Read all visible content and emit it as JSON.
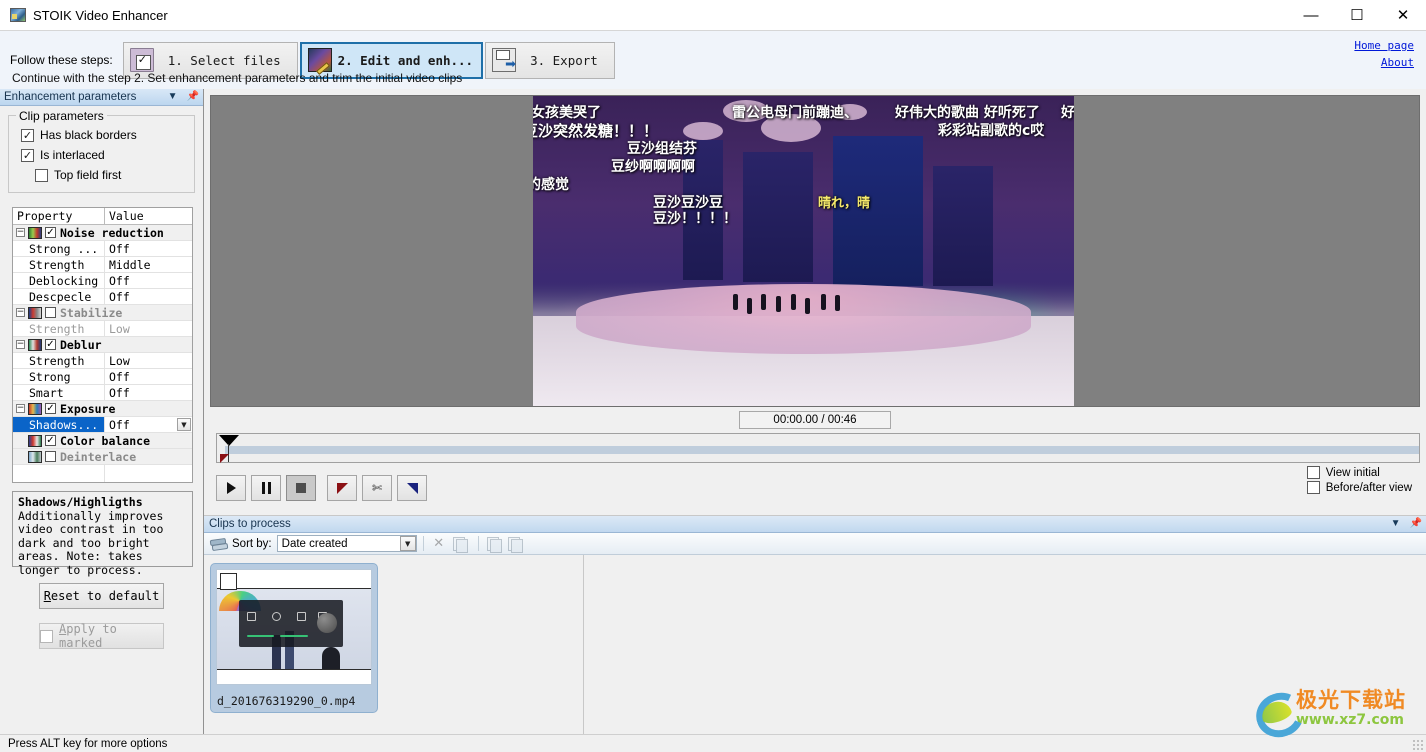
{
  "window": {
    "title": "STOIK Video Enhancer",
    "icon": "app-icon",
    "minimize": "—",
    "maximize": "☐",
    "close": "✕"
  },
  "toolbar": {
    "steps_label": "Follow these steps:",
    "steps": [
      {
        "label": "1. Select files",
        "icon": "select-files-icon",
        "active": false
      },
      {
        "label": "2. Edit and enh...",
        "icon": "edit-enhance-icon",
        "active": true
      },
      {
        "label": "3. Export",
        "icon": "export-icon",
        "active": false
      }
    ],
    "hint": "Continue with the step 2. Set enhancement parameters and trim the initial video clips",
    "links": [
      {
        "label": "Home page"
      },
      {
        "label": "About"
      }
    ]
  },
  "left_panel": {
    "title": "Enhancement parameters",
    "collapse_icon": "chevron-down-icon",
    "pin_icon": "pin-icon",
    "clip_parameters": {
      "group_title": "Clip parameters",
      "checkboxes": [
        {
          "label": "Has black borders",
          "checked": true
        },
        {
          "label": "Is interlaced",
          "checked": true
        },
        {
          "label": "Top field first",
          "checked": false
        }
      ]
    },
    "property_grid": {
      "headers": {
        "property": "Property",
        "value": "Value"
      },
      "rows": [
        {
          "kind": "group",
          "name": "Noise reduction",
          "checked": true,
          "expanded": true,
          "icon": "filmstrip-icon-1"
        },
        {
          "kind": "leaf",
          "name": "Strong ...",
          "value": "Off"
        },
        {
          "kind": "leaf",
          "name": "Strength",
          "value": "Middle"
        },
        {
          "kind": "leaf",
          "name": "Deblocking",
          "value": "Off"
        },
        {
          "kind": "leaf",
          "name": "Descpecle",
          "value": "Off"
        },
        {
          "kind": "group",
          "name": "Stabilize",
          "checked": false,
          "expanded": true,
          "icon": "filmstrip-icon-2"
        },
        {
          "kind": "leaf",
          "name": "Strength",
          "value": "Low",
          "disabled": true
        },
        {
          "kind": "group",
          "name": "Deblur",
          "checked": true,
          "expanded": true,
          "icon": "filmstrip-icon-3"
        },
        {
          "kind": "leaf",
          "name": "Strength",
          "value": "Low"
        },
        {
          "kind": "leaf",
          "name": "Strong",
          "value": "Off"
        },
        {
          "kind": "leaf",
          "name": "Smart",
          "value": "Off"
        },
        {
          "kind": "group",
          "name": "Exposure",
          "checked": true,
          "expanded": true,
          "icon": "filmstrip-icon-4"
        },
        {
          "kind": "leaf",
          "name": "Shadows...",
          "value": "Off",
          "selected": true,
          "dropdown": true
        },
        {
          "kind": "group2",
          "name": "Color balance",
          "checked": true,
          "icon": "filmstrip-icon-5"
        },
        {
          "kind": "group2",
          "name": "Deinterlace",
          "checked": false,
          "icon": "filmstrip-icon-6"
        }
      ]
    },
    "description": {
      "title": "Shadows/Highligths",
      "body": "Additionally improves video contrast in too dark and too bright areas. Note: takes longer to process."
    },
    "reset_button": "Reset to default",
    "apply_button": {
      "label": "Apply to marked",
      "checked": false,
      "disabled": true
    }
  },
  "preview": {
    "timecode": "00:00.00 / 00:46",
    "danmaku": [
      "女孩美哭了",
      "豆沙突然发糖！！！",
      "的感觉",
      "豆沙组结芬",
      "豆纱啊啊啊啊",
      "豆沙豆沙豆",
      "豆沙！！！！",
      "雷公电母门前蹦迪、",
      "好伟大的歌曲 好听死了",
      "彩彩站副歌的c哎",
      "晴れ，晴",
      "好"
    ],
    "controls": [
      {
        "name": "play-button",
        "icon": "play-icon"
      },
      {
        "name": "pause-button",
        "icon": "pause-icon"
      },
      {
        "name": "stop-button",
        "icon": "stop-icon"
      },
      {
        "name": "set-in-point-button",
        "icon": "mark-in-icon"
      },
      {
        "name": "cut-button",
        "icon": "scissors-icon"
      },
      {
        "name": "set-out-point-button",
        "icon": "mark-out-icon"
      }
    ],
    "view_options": [
      {
        "label": "View initial",
        "checked": false
      },
      {
        "label": "Before/after view",
        "checked": false
      }
    ]
  },
  "clips_panel": {
    "title": "Clips to process",
    "collapse_icon": "chevron-down-icon",
    "pin_icon": "pin-icon",
    "sort_label": "Sort by:",
    "sort_value": "Date created",
    "toolbar_icons": [
      {
        "name": "delete-clip-icon",
        "glyph": "✕"
      },
      {
        "name": "duplicate-clip-icon"
      },
      {
        "name": "mark-clip-icon"
      },
      {
        "name": "unmark-clip-icon"
      }
    ],
    "clips": [
      {
        "filename": "d_201676319290_0.mp4",
        "checked": false,
        "selected": true
      }
    ]
  },
  "status_bar": {
    "message": "Press ALT key for more options"
  },
  "watermark": {
    "cn_text": "极光下载站",
    "url_text": "www.xz7.com"
  },
  "colors": {
    "accent": "#1e6fa8",
    "active_tab_bg": "#cfe6f7",
    "selection": "#0a64c8",
    "link": "#0018d8",
    "panel_header": "#bcd6ef"
  }
}
